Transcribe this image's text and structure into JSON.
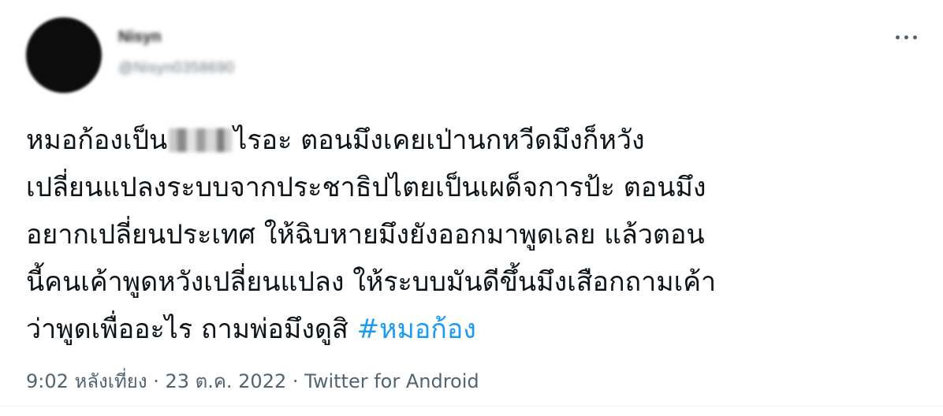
{
  "author": {
    "display_name": "Nisyn",
    "handle": "@Nisyn0358690"
  },
  "tweet": {
    "lines": [
      {
        "before": "หมอก้องเป็น",
        "after": "ไรอะ ตอนมึงเคยเป่านกหวีดมึงก็หวัง"
      },
      {
        "text": "เปลี่ยนแปลงระบบจากประชาธิปไตยเป็นเผด็จการป้ะ ตอนมึง"
      },
      {
        "text": "อยากเปลี่ยนประเทศ ให้ฉิบหายมึงยังออกมาพูดเลย แล้วตอน"
      },
      {
        "text": "นี้คนเค้าพูดหวังเปลี่ยนแปลง ให้ระบบมันดีขึ้นมึงเสือกถามเค้า"
      },
      {
        "before": "ว่าพูดเพื่ออะไร ถามพ่อมึงดูสิ ",
        "hashtag": "#หมอก้อง"
      }
    ]
  },
  "meta": {
    "time": "9:02 หลังเที่ยง",
    "sep1": " · ",
    "date": "23 ต.ค. 2022",
    "sep2": " · ",
    "source": "Twitter for Android"
  },
  "icons": {
    "more": "more-horizontal-icon"
  },
  "colors": {
    "text": "#0f1419",
    "secondary": "#536471",
    "link": "#1d9bf0"
  }
}
